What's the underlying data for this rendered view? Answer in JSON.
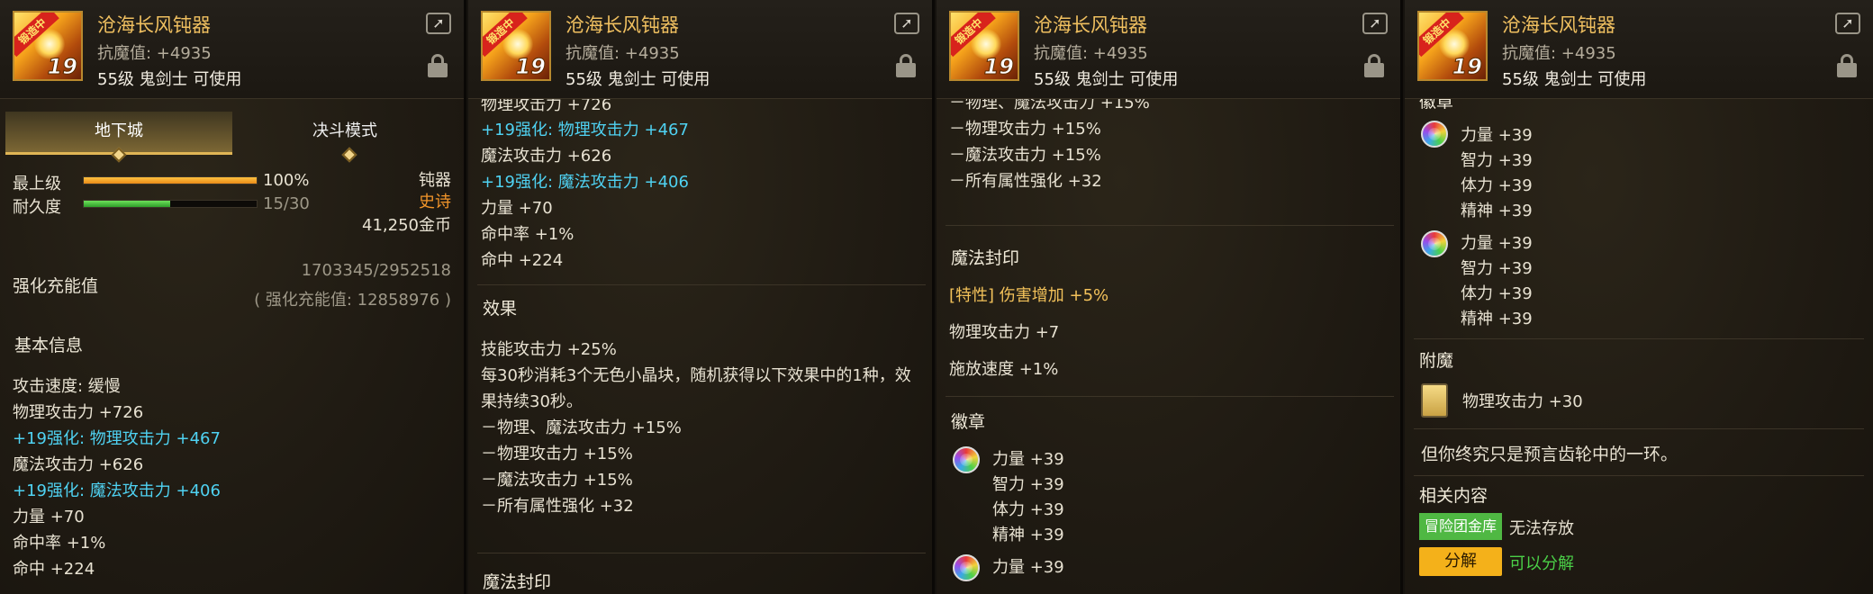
{
  "item": {
    "name": "沧海长风钝器",
    "resist": "抗魔值: +4935",
    "requirement": "55级 鬼剑士 可使用",
    "icon_badge": "锻造中",
    "icon_level": "19",
    "colors": {
      "name": "#f0c060",
      "blue_stat": "#4fd2f2",
      "epic": "#f2952a",
      "green": "#4bd048"
    },
    "icons": {
      "share": "share-icon",
      "lock": "lock-icon"
    }
  },
  "tabs": [
    "地下城",
    "决斗模式"
  ],
  "grade": {
    "label": "最上级",
    "value": "100%",
    "fill": 1.0,
    "durability_label": "耐久度",
    "durability_value": "15/30",
    "durability_fill": 0.5,
    "type": "钝器",
    "rarity": "史诗",
    "price": "41,250金币"
  },
  "reinforce": {
    "label": "强化充能值",
    "progress": "1703345/2952518",
    "total": "( 强化充能值: 12858976 )"
  },
  "basic": {
    "title": "基本信息",
    "stats": [
      {
        "text": "攻击速度: 缓慢",
        "style": "t"
      },
      {
        "text": "物理攻击力 +726",
        "style": "t"
      },
      {
        "text": "+19强化: 物理攻击力 +467",
        "style": "blue"
      },
      {
        "text": "魔法攻击力 +626",
        "style": "t"
      },
      {
        "text": "+19强化: 魔法攻击力 +406",
        "style": "blue"
      },
      {
        "text": "力量 +70",
        "style": "t"
      },
      {
        "text": "命中率 +1%",
        "style": "t"
      },
      {
        "text": "命中 +224",
        "style": "t"
      }
    ],
    "cut_top": "物理攻击力 +726"
  },
  "effect": {
    "title": "效果",
    "line1": "技能攻击力 +25%",
    "line2": "每30秒消耗3个无色小晶块，随机获得以下效果中的1种，效",
    "line3": "果持续30秒。",
    "opts": [
      "－物理、魔法攻击力 +15%",
      "－物理攻击力 +15%",
      "－魔法攻击力 +15%",
      "－所有属性强化 +32"
    ],
    "cut_bottom": "魔法封印"
  },
  "seal": {
    "title": "魔法封印",
    "trait": "[特性] 伤害增加 +5%",
    "line1": "物理攻击力 +7",
    "line2": "施放速度 +1%"
  },
  "emblem": {
    "title": "徽章",
    "lines": [
      "力量 +39",
      "智力 +39",
      "体力 +39",
      "精神 +39"
    ],
    "cut_top": "徽章"
  },
  "enchant": {
    "title": "附魔",
    "value": "物理攻击力 +30"
  },
  "flavor": "但你终究只是预言齿轮中的一环。",
  "related": {
    "title": "相关内容",
    "bank_button": "冒险团金库",
    "bank_status": "无法存放",
    "decompose_button": "分解",
    "decompose_status": "可以分解"
  }
}
